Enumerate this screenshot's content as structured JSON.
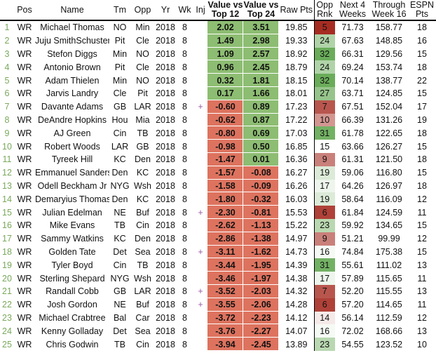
{
  "colors": {
    "positive": "#8dbd72",
    "negative": "#dd735f",
    "index": "#79a95b",
    "injury": "#9a5aa0"
  },
  "headers": [
    "",
    "Pos",
    "Name",
    "Tm",
    "Opp",
    "Yr",
    "Wk",
    "Inj",
    "Value vs Top 12",
    "Value vs Top 24",
    "Raw Pts",
    "Opp Rnk",
    "Next 4 Weeks",
    "Through Week 16",
    "ESPN Pts"
  ],
  "rows": [
    [
      "1",
      "WR",
      "Michael Thomas",
      "NO",
      "Min",
      "2018",
      "8",
      "",
      "2.02",
      "3.51",
      "19.85",
      "5",
      "71.73",
      "158.77",
      "18"
    ],
    [
      "2",
      "WR",
      "Juju SmithSchuster",
      "Pit",
      "Cle",
      "2018",
      "8",
      "",
      "1.49",
      "2.98",
      "19.33",
      "24",
      "67.63",
      "148.85",
      "16"
    ],
    [
      "3",
      "WR",
      "Stefon Diggs",
      "Min",
      "NO",
      "2018",
      "8",
      "",
      "1.09",
      "2.57",
      "18.92",
      "32",
      "66.31",
      "129.56",
      "15"
    ],
    [
      "4",
      "WR",
      "Antonio Brown",
      "Pit",
      "Cle",
      "2018",
      "8",
      "",
      "0.96",
      "2.45",
      "18.79",
      "24",
      "69.24",
      "153.74",
      "18"
    ],
    [
      "5",
      "WR",
      "Adam Thielen",
      "Min",
      "NO",
      "2018",
      "8",
      "",
      "0.32",
      "1.81",
      "18.15",
      "32",
      "70.14",
      "138.77",
      "22"
    ],
    [
      "6",
      "WR",
      "Jarvis Landry",
      "Cle",
      "Pit",
      "2018",
      "8",
      "",
      "0.17",
      "1.66",
      "18.01",
      "27",
      "63.71",
      "124.85",
      "15"
    ],
    [
      "7",
      "WR",
      "Davante Adams",
      "GB",
      "LAR",
      "2018",
      "8",
      "+",
      "-0.60",
      "0.89",
      "17.23",
      "7",
      "67.51",
      "152.04",
      "17"
    ],
    [
      "8",
      "WR",
      "DeAndre Hopkins",
      "Hou",
      "Mia",
      "2018",
      "8",
      "",
      "-0.62",
      "0.87",
      "17.22",
      "10",
      "66.39",
      "131.26",
      "19"
    ],
    [
      "9",
      "WR",
      "AJ Green",
      "Cin",
      "TB",
      "2018",
      "8",
      "",
      "-0.80",
      "0.69",
      "17.03",
      "31",
      "61.78",
      "122.65",
      "18"
    ],
    [
      "10",
      "WR",
      "Robert Woods",
      "LAR",
      "GB",
      "2018",
      "8",
      "",
      "-0.98",
      "0.50",
      "16.85",
      "15",
      "63.66",
      "126.27",
      "15"
    ],
    [
      "11",
      "WR",
      "Tyreek Hill",
      "KC",
      "Den",
      "2018",
      "8",
      "",
      "-1.47",
      "0.01",
      "16.36",
      "9",
      "61.31",
      "121.50",
      "18"
    ],
    [
      "12",
      "WR",
      "Emmanuel Sanders",
      "Den",
      "KC",
      "2018",
      "8",
      "",
      "-1.57",
      "-0.08",
      "16.27",
      "19",
      "59.06",
      "116.80",
      "15"
    ],
    [
      "13",
      "WR",
      "Odell Beckham Jr",
      "NYG",
      "Wsh",
      "2018",
      "8",
      "",
      "-1.58",
      "-0.09",
      "16.26",
      "17",
      "64.26",
      "126.97",
      "18"
    ],
    [
      "14",
      "WR",
      "Demaryius Thomas",
      "Den",
      "KC",
      "2018",
      "8",
      "",
      "-1.80",
      "-0.32",
      "16.03",
      "19",
      "58.64",
      "116.09",
      "12"
    ],
    [
      "15",
      "WR",
      "Julian Edelman",
      "NE",
      "Buf",
      "2018",
      "8",
      "+",
      "-2.30",
      "-0.81",
      "15.53",
      "6",
      "61.84",
      "124.59",
      "11"
    ],
    [
      "16",
      "WR",
      "Mike Evans",
      "TB",
      "Cin",
      "2018",
      "8",
      "",
      "-2.62",
      "-1.13",
      "15.22",
      "23",
      "59.92",
      "134.65",
      "15"
    ],
    [
      "17",
      "WR",
      "Sammy Watkins",
      "KC",
      "Den",
      "2018",
      "8",
      "",
      "-2.86",
      "-1.38",
      "14.97",
      "9",
      "51.21",
      "99.99",
      "12"
    ],
    [
      "18",
      "WR",
      "Golden Tate",
      "Det",
      "Sea",
      "2018",
      "8",
      "+",
      "-3.11",
      "-1.62",
      "14.73",
      "16",
      "74.84",
      "175.38",
      "15"
    ],
    [
      "19",
      "WR",
      "Tyler Boyd",
      "Cin",
      "TB",
      "2018",
      "8",
      "",
      "-3.44",
      "-1.95",
      "14.39",
      "31",
      "55.61",
      "111.02",
      "13"
    ],
    [
      "20",
      "WR",
      "Sterling Shepard",
      "NYG",
      "Wsh",
      "2018",
      "8",
      "",
      "-3.46",
      "-1.97",
      "14.38",
      "17",
      "57.89",
      "115.65",
      "11"
    ],
    [
      "21",
      "WR",
      "Randall Cobb",
      "GB",
      "LAR",
      "2018",
      "8",
      "+",
      "-3.52",
      "-2.03",
      "14.32",
      "7",
      "52.20",
      "115.55",
      "13"
    ],
    [
      "22",
      "WR",
      "Josh Gordon",
      "NE",
      "Buf",
      "2018",
      "8",
      "+",
      "-3.55",
      "-2.06",
      "14.28",
      "6",
      "57.20",
      "114.65",
      "11"
    ],
    [
      "23",
      "WR",
      "Michael Crabtree",
      "Bal",
      "Car",
      "2018",
      "8",
      "",
      "-3.72",
      "-2.23",
      "14.12",
      "14",
      "56.14",
      "112.59",
      "12"
    ],
    [
      "24",
      "WR",
      "Kenny Golladay",
      "Det",
      "Sea",
      "2018",
      "8",
      "",
      "-3.76",
      "-2.27",
      "14.07",
      "16",
      "72.02",
      "168.66",
      "13"
    ],
    [
      "25",
      "WR",
      "Chris Godwin",
      "TB",
      "Cin",
      "2018",
      "8",
      "",
      "-3.94",
      "-2.45",
      "13.89",
      "23",
      "54.55",
      "123.52",
      "10"
    ]
  ]
}
